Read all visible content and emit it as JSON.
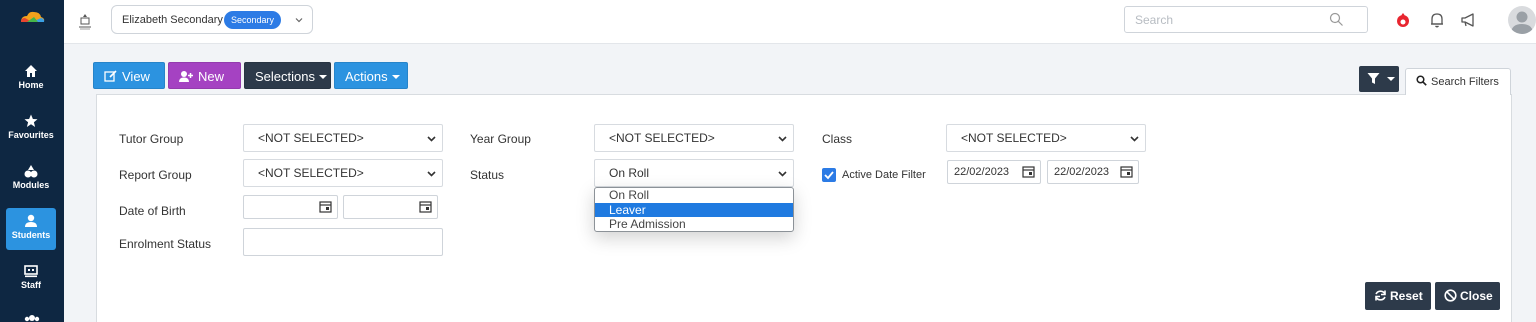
{
  "sidebar": {
    "items": [
      {
        "label": "Home",
        "icon": "home-icon"
      },
      {
        "label": "Favourites",
        "icon": "star-icon"
      },
      {
        "label": "Modules",
        "icon": "modules-icon"
      },
      {
        "label": "Students",
        "icon": "user-icon",
        "active": true
      },
      {
        "label": "Staff",
        "icon": "staff-icon"
      }
    ]
  },
  "topbar": {
    "school_name": "Elizabeth Secondary",
    "school_badge": "Secondary",
    "search_placeholder": "Search"
  },
  "toolbar": {
    "view_label": "View",
    "new_label": "New",
    "selections_label": "Selections",
    "actions_label": "Actions",
    "search_filters_tab": "Search Filters"
  },
  "filters": {
    "tutor_group": {
      "label": "Tutor Group",
      "value": "<NOT SELECTED>"
    },
    "year_group": {
      "label": "Year Group",
      "value": "<NOT SELECTED>"
    },
    "class": {
      "label": "Class",
      "value": "<NOT SELECTED>"
    },
    "report_group": {
      "label": "Report Group",
      "value": "<NOT SELECTED>"
    },
    "status": {
      "label": "Status",
      "value": "On Roll",
      "options": [
        "On Roll",
        "Leaver",
        "Pre Admission"
      ],
      "highlighted": "Leaver"
    },
    "active_date_filter": {
      "label": "Active Date Filter",
      "checked": true,
      "from": "22/02/2023",
      "to": "22/02/2023"
    },
    "date_of_birth": {
      "label": "Date of Birth",
      "from": "",
      "to": ""
    },
    "enrolment_status": {
      "label": "Enrolment Status",
      "value": ""
    }
  },
  "actions": {
    "reset_label": "Reset",
    "close_label": "Close"
  },
  "colors": {
    "sidebar_bg": "#0e2742",
    "primary": "#2c93e0",
    "purple": "#a542c2",
    "dark": "#2d3a4a"
  }
}
